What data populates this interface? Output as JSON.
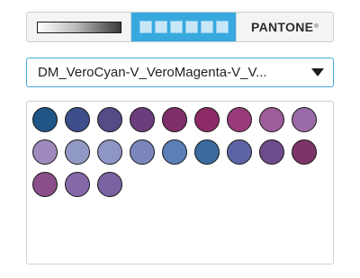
{
  "tabs": {
    "gradient": {
      "icon": "gradient-bar-icon"
    },
    "swatches": {
      "icon": "swatch-grid-icon",
      "active": true,
      "accent": "#38a9df"
    },
    "pantone": {
      "label": "PANTONE",
      "mark": "®"
    }
  },
  "dropdown": {
    "value": "DM_VeroCyan-V_VeroMagenta-V_V...",
    "icon": "caret-down-icon"
  },
  "swatches": [
    "#1f5585",
    "#3c4f8a",
    "#564a87",
    "#6c3d7d",
    "#7e2f68",
    "#8c2b66",
    "#993a7a",
    "#9e5c9a",
    "#9a6aa6",
    "#9f8abd",
    "#9099c3",
    "#8d96c5",
    "#7a86bd",
    "#5b7fb6",
    "#3c6a9e",
    "#5c64a5",
    "#6d4c8b",
    "#7d3467",
    "#8a4e8a",
    "#8468a8",
    "#7a62a3"
  ]
}
